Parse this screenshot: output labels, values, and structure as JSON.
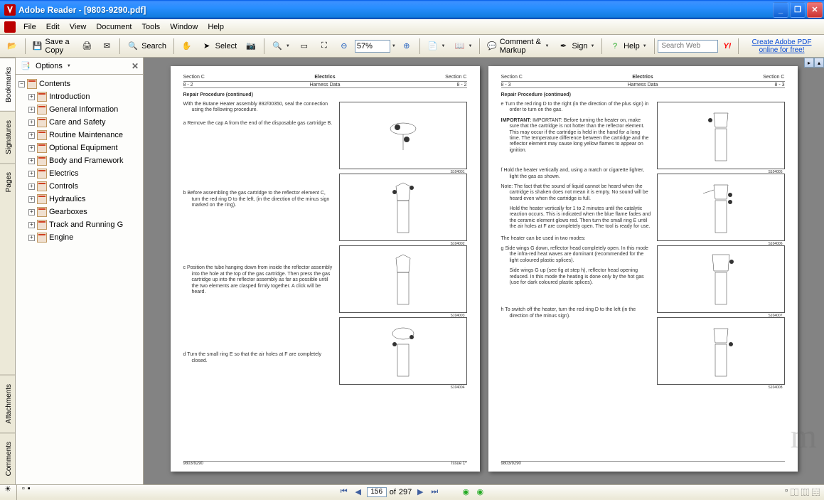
{
  "window": {
    "title": "Adobe Reader - [9803-9290.pdf]"
  },
  "menu": [
    "File",
    "Edit",
    "View",
    "Document",
    "Tools",
    "Window",
    "Help"
  ],
  "toolbar": {
    "save_copy": "Save a Copy",
    "search": "Search",
    "select": "Select",
    "zoom_value": "57%",
    "comment": "Comment & Markup",
    "sign": "Sign",
    "help": "Help",
    "search_web_placeholder": "Search Web",
    "create_pdf": "Create Adobe PDF online for free!"
  },
  "sidebar_tabs": [
    "Bookmarks",
    "Signatures",
    "Pages",
    "Attachments",
    "Comments"
  ],
  "bookmarks": {
    "options_label": "Options",
    "root": "Contents",
    "items": [
      "Introduction",
      "General Information",
      "Care and Safety",
      "Routine Maintenance",
      "Optional Equipment",
      "Body and Framework",
      "Electrics",
      "Controls",
      "Hydraulics",
      "Gearboxes",
      "Track and Running G",
      "Engine"
    ]
  },
  "pages": {
    "left": {
      "section_l": "Section C",
      "section_c": "Electrics",
      "section_r": "Section C",
      "sub_l": "8 - 2",
      "sub_c": "Harness Data",
      "sub_r": "8 - 2",
      "title": "Repair Procedure (continued)",
      "intro": "With the Butane Heater assembly 892/00350, seal the connection using the following procedure.",
      "step_a": "a  Remove the cap A from the end of the disposable gas cartridge B.",
      "step_b": "b  Before assembling the gas cartridge to the reflector element C, turn the red ring D to the left, (in the direction of the minus sign marked on the ring).",
      "step_c": "c  Position the tube hanging down from inside the reflector assembly into the hole at the top of the gas cartridge. Then press the gas cartridge up into the reflector assembly as far as possible until the two elements are clasped firmly together. A click will be heard.",
      "step_d": "d  Turn the small ring E so that the air holes at F are completely closed.",
      "footer_l": "9803/9290",
      "footer_r": "Issue 1*"
    },
    "right": {
      "section_l": "Section C",
      "section_c": "Electrics",
      "section_r": "Section C",
      "sub_l": "8 - 3",
      "sub_c": "Harness Data",
      "sub_r": "8 - 3",
      "title": "Repair Procedure (continued)",
      "step_e": "e  Turn the red ring D to the right (in the direction of the plus sign) in order to turn on the gas.",
      "important": "IMPORTANT: Before turning the heater on, make sure that the cartridge is not hotter than the reflector element. This may occur if the cartridge is held in the hand for a long time. The temperature difference between the cartridge and the reflector element may cause long yellow flames to appear on ignition.",
      "step_f": "f  Hold the heater vertically and, using a match or cigarette lighter, light the gas as shown.",
      "note_f": "Note: The fact that the sound of liquid cannot be heard when the cartridge is shaken does not mean it is empty. No sound will be heard even when the cartridge is full.",
      "step_f2": "Hold the heater vertically for 1 to 2 minutes until the catalytic reaction occurs. This is indicated when the blue flame fades and the ceramic element glows red. Then turn the small ring E until the air holes at F are completely open. The tool is ready for use.",
      "modes": "The heater can be used in two modes:",
      "step_g": "g  Side wings G down, reflector head completely open. In this mode the infra-red heat waves are dominant (recommended for the light coloured plastic splices).",
      "step_g2": "Side wings G up (see fig at step h), reflector head opening reduced. In this mode the heating is done only by the hot gas (use for dark coloured plastic splices).",
      "step_h": "h  To switch off the heater, turn the red ring D to the left (in the direction of the minus sign).",
      "footer_l": "9803/9290",
      "footer_r": ""
    }
  },
  "nav": {
    "current_page": "156",
    "total_pages": "297",
    "of_label": "of"
  },
  "fig_labels": [
    "S104001",
    "S104002",
    "S104003",
    "S104004",
    "S104005",
    "S104006",
    "S104007",
    "S104008"
  ]
}
